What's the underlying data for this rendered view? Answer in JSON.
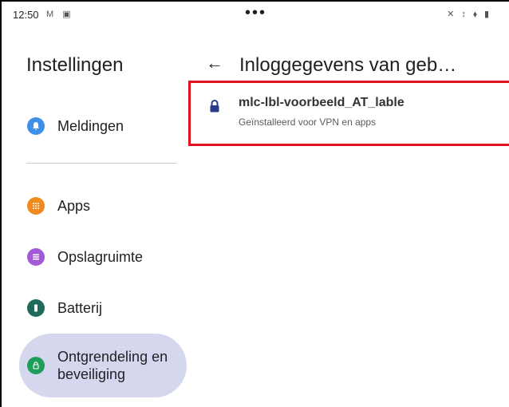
{
  "status_bar": {
    "time": "12:50",
    "left_icons": "M ▣",
    "center": "•••",
    "right_icons": "✕ ↕ ⬧ ▮"
  },
  "left_pane": {
    "title": "Instellingen",
    "items": [
      {
        "label": "Meldingen",
        "icon": "bell-icon",
        "color": "#3d8fe8"
      },
      {
        "label": "Apps",
        "icon": "apps-grid-icon",
        "color": "#f08a1e"
      },
      {
        "label": "Opslagruimte",
        "icon": "storage-icon",
        "color": "#a25bd6"
      },
      {
        "label": "Batterij",
        "icon": "battery-icon",
        "color": "#1e6b5c"
      },
      {
        "label": "Ontgrendeling en beveiliging",
        "icon": "lock-icon",
        "color": "#1f9d5a",
        "selected": true
      }
    ]
  },
  "right_pane": {
    "title": "Inloggegevens van geb…",
    "credential": {
      "name": "mlc-lbl-voorbeeld_AT_lable",
      "subtitle": "Geïnstalleerd voor VPN en apps"
    }
  },
  "colors": {
    "highlight_border": "#e0141e",
    "selected_bg": "#d5d7ef",
    "lock_icon": "#2b3a8a"
  }
}
